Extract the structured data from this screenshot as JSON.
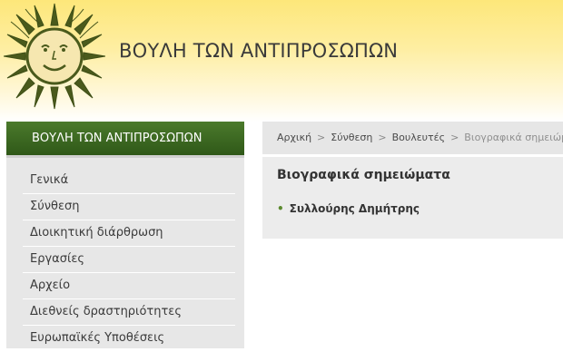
{
  "header": {
    "logo_icon": "sun-face-icon",
    "title": "ΒΟΥΛΗ ΤΩΝ ΑΝΤΙΠΡΟΣΩΠΩΝ"
  },
  "sidebar": {
    "heading": "ΒΟΥΛΗ ΤΩΝ ΑΝΤΙΠΡΟΣΩΠΩΝ",
    "items": [
      {
        "label": "Γενικά"
      },
      {
        "label": "Σύνθεση"
      },
      {
        "label": "Διοικητική διάρθρωση"
      },
      {
        "label": "Εργασίες"
      },
      {
        "label": "Αρχείο"
      },
      {
        "label": "Διεθνείς δραστηριότητες"
      },
      {
        "label": "Ευρωπαϊκές Υποθέσεις"
      }
    ]
  },
  "breadcrumb": {
    "separator": ">",
    "items": [
      "Αρχική",
      "Σύνθεση",
      "Βουλευτές"
    ],
    "current": "Βιογραφικά σημειώμ..."
  },
  "main": {
    "title": "Βιογραφικά σημειώματα",
    "bullet": "•",
    "members": [
      "Συλλούρης Δημήτρης"
    ]
  },
  "colors": {
    "accent_green": "#3d6a22",
    "header_yellow": "#fde77a",
    "panel_gray": "#ececec"
  }
}
